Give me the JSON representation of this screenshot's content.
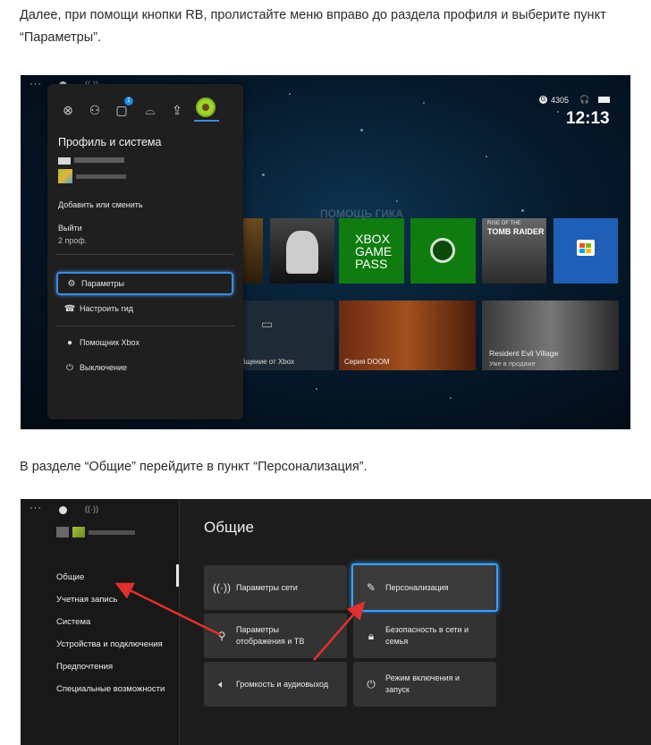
{
  "article": {
    "paragraph1": "Далее, при помощи кнопки RB, пролистайте меню вправо до раздела профиля и выберите пункт “Параметры”.",
    "paragraph2": "В разделе “Общие” перейдите в пункт “Персонализация”."
  },
  "screenshot1": {
    "status": {
      "gamerscore": "4305",
      "time": "12:13"
    },
    "tab_icons": [
      "xbox-logo-icon",
      "people-icon",
      "chat-icon",
      "controller-icon",
      "upload-icon",
      "avatar"
    ],
    "chat_badge": "1",
    "menu": {
      "title": "Профиль и система",
      "add_or_switch": "Добавить или сменить",
      "sign_out": "Выйти",
      "profiles_count": "2 проф.",
      "items": {
        "settings": "Параметры",
        "guide_setup": "Настроить гид",
        "xbox_assist": "Помощник Xbox",
        "power": "Выключение"
      }
    },
    "tiles": {
      "gamepass_line1": "XBOX",
      "gamepass_line2": "GAME",
      "gamepass_line3": "PASS",
      "tombraider": "TOMB RAIDER",
      "tombraider_sub": "RISE OF THE",
      "message_label": "е сообщение от Xbox",
      "doom_label": "Серия DOOM",
      "re_title": "Resident Evil Village",
      "re_sub": "Уже в продаже"
    },
    "watermark": "ПОМОЩЬ ГИКА"
  },
  "screenshot2": {
    "title": "Общие",
    "nav": [
      "Общие",
      "Учетная запись",
      "Система",
      "Устройства и подключения",
      "Предпочтения",
      "Специальные возможности"
    ],
    "cards": {
      "network": "Параметры сети",
      "personalization": "Персонализация",
      "display_line1": "Параметры",
      "display_line2": "отображения и ТВ",
      "security_line1": "Безопасность в сети и",
      "security_line2": "семья",
      "volume": "Громкость и аудиовыход",
      "power_line1": "Режим включения и",
      "power_line2": "запуск"
    },
    "arrow_color": "#e03030",
    "accent_color": "#3aa0ff"
  }
}
